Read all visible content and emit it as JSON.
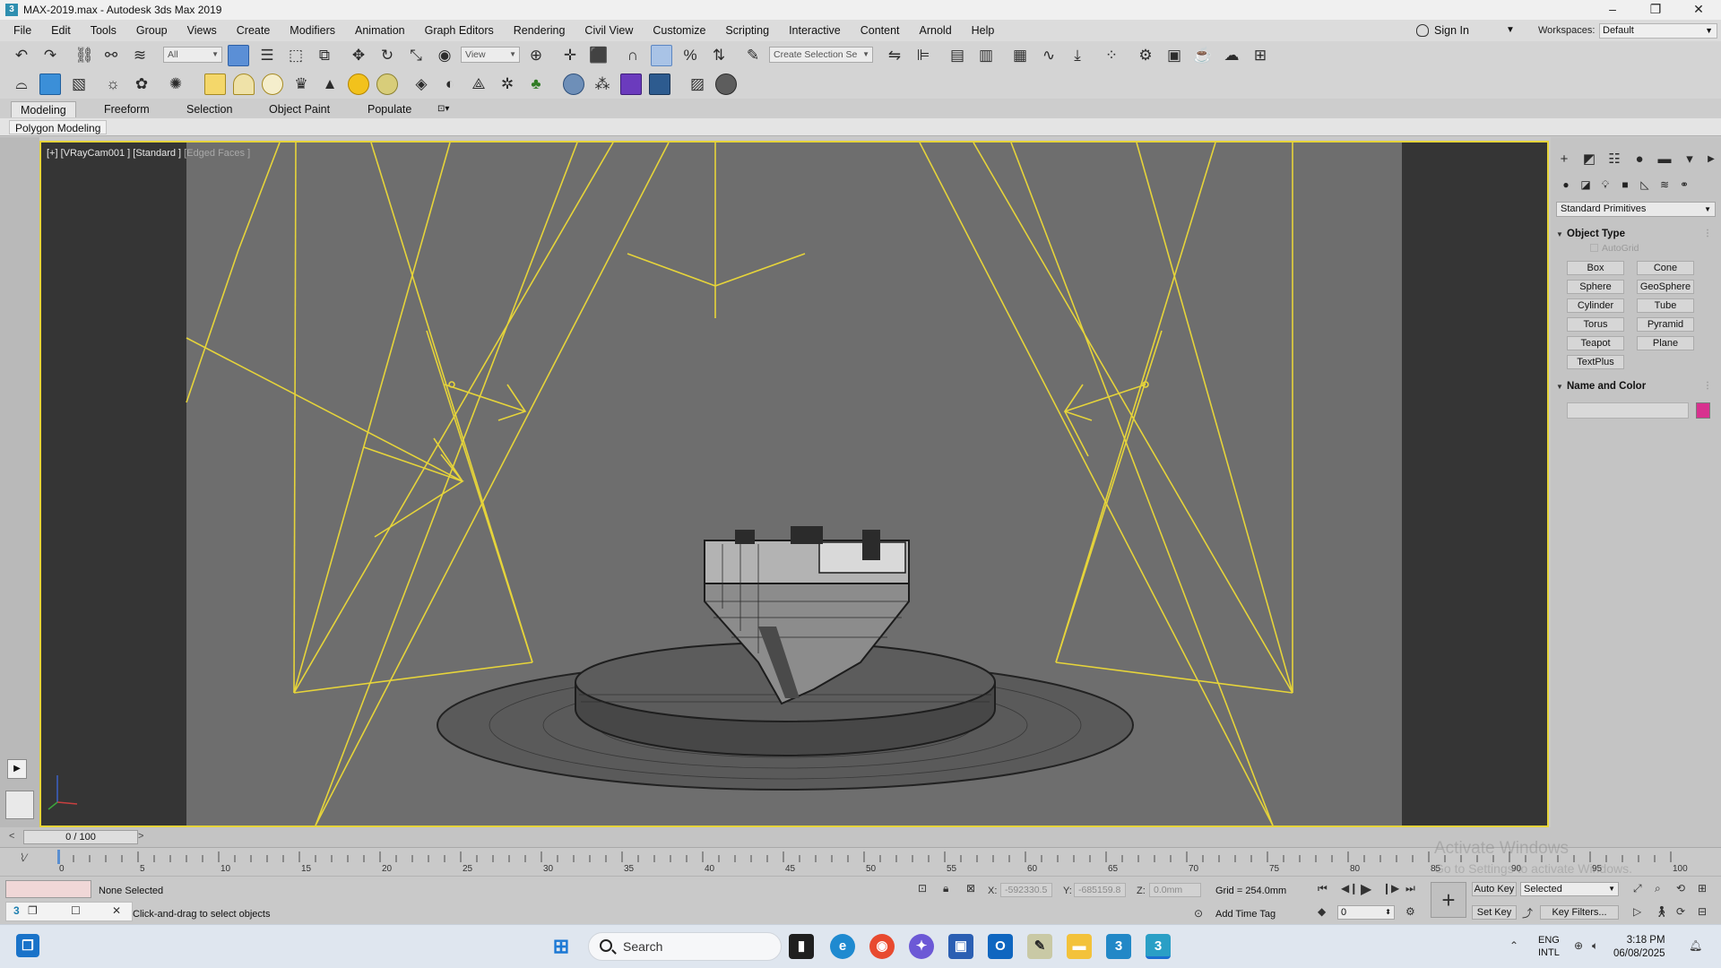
{
  "window": {
    "title": "MAX-2019.max - Autodesk 3ds Max 2019",
    "app_icon_text": "3",
    "controls": [
      "minimize-icon",
      "maximize-icon",
      "close-icon"
    ],
    "min_glyph": "–",
    "max_glyph": "❐",
    "close_glyph": "✕"
  },
  "menu": {
    "items": [
      "File",
      "Edit",
      "Tools",
      "Group",
      "Views",
      "Create",
      "Modifiers",
      "Animation",
      "Graph Editors",
      "Rendering",
      "Civil View",
      "Customize",
      "Scripting",
      "Interactive",
      "Content",
      "Arnold",
      "Help"
    ],
    "sign_in": "Sign In",
    "workspaces_label": "Workspaces:",
    "workspaces_value": "Default"
  },
  "toolbar": {
    "filter_value": "All",
    "ref_coord_value": "View",
    "named_selection_value": "Create Selection Se"
  },
  "ribbon": {
    "tabs": [
      "Modeling",
      "Freeform",
      "Selection",
      "Object Paint",
      "Populate"
    ],
    "active_tab": "Modeling",
    "panel_label": "Polygon Modeling"
  },
  "viewport": {
    "label_main": "[+] [VRayCam001 ] [Standard ]",
    "label_mode": "[Edged Faces ]",
    "accent_color": "#e6d43a",
    "background_color": "#6e6e6e",
    "axis_labels": [
      "x",
      "y",
      "z"
    ]
  },
  "command_panel": {
    "dropdown": "Standard Primitives",
    "object_type_title": "Object Type",
    "autogrid_label": "AutoGrid",
    "primitives": [
      "Box",
      "Cone",
      "Sphere",
      "GeoSphere",
      "Cylinder",
      "Tube",
      "Torus",
      "Pyramid",
      "Teapot",
      "Plane",
      "TextPlus"
    ],
    "name_color_title": "Name and Color",
    "object_color": "#d8318f"
  },
  "timeline": {
    "frame_display": "0 / 100",
    "ticks": [
      "0",
      "5",
      "10",
      "15",
      "20",
      "25",
      "30",
      "35",
      "40",
      "45",
      "50",
      "55",
      "60",
      "65",
      "70",
      "75",
      "80",
      "85",
      "90",
      "95",
      "100"
    ]
  },
  "status": {
    "selection_text": "None Selected",
    "prompt_text": "Click-and-drag to select objects",
    "x_label": "X:",
    "x_value": "-592330.5",
    "y_label": "Y:",
    "y_value": "-685159.8",
    "z_label": "Z:",
    "z_value": "0.0mm",
    "grid_text": "Grid = 254.0mm",
    "add_time_tag": "Add Time Tag",
    "auto_key": "Auto Key",
    "set_key": "Set Key",
    "selected_value": "Selected",
    "key_filters": "Key Filters...",
    "frame_value": "0"
  },
  "watermark": {
    "title": "Activate Windows",
    "subtitle": "Go to Settings to activate Windows."
  },
  "taskbar": {
    "search_placeholder": "Search",
    "lang_line1": "ENG",
    "lang_line2": "INTL",
    "time": "3:18 PM",
    "date": "06/08/2025"
  }
}
